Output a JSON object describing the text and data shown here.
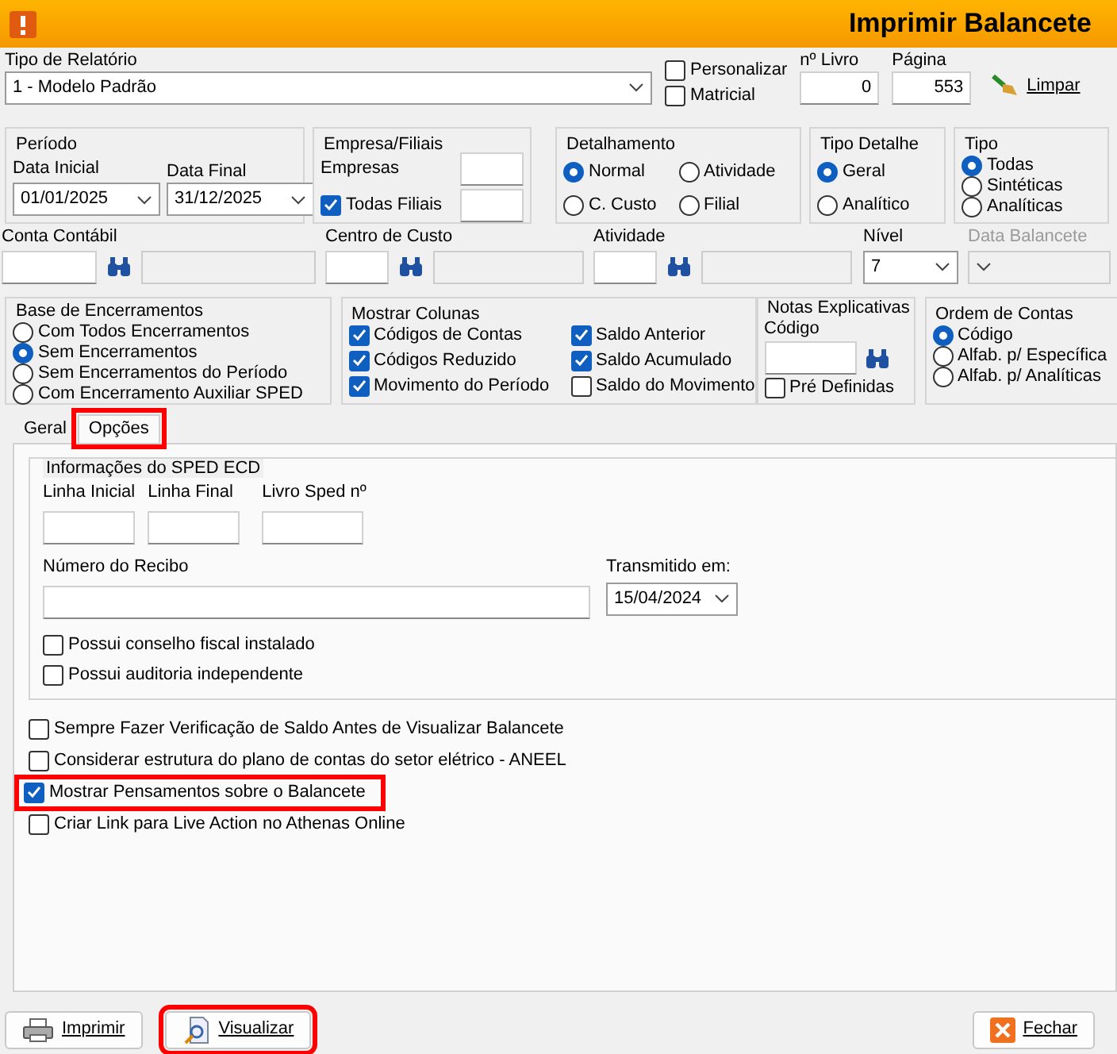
{
  "window": {
    "title": "Imprimir Balancete"
  },
  "report": {
    "type_label": "Tipo de Relatório",
    "type_value": "1 - Modelo Padrão",
    "options": [
      {
        "label": "Personalizar",
        "checked": false
      },
      {
        "label": "Matricial",
        "checked": false
      }
    ],
    "book_label": "nº Livro",
    "book_value": "0",
    "page_label": "Página",
    "page_value": "553",
    "clear_button": "Limpar"
  },
  "periodo": {
    "title": "Período",
    "start_label": "Data Inicial",
    "start_value": "01/01/2025",
    "end_label": "Data Final",
    "end_value": "31/12/2025"
  },
  "empresa": {
    "title": "Empresa/Filiais",
    "empresas_label": "Empresas",
    "filiais": {
      "label": "Todas Filiais",
      "checked": true
    }
  },
  "detalhamento": {
    "title": "Detalhamento",
    "options": [
      {
        "label": "Normal",
        "selected": true
      },
      {
        "label": "Atividade",
        "selected": false
      },
      {
        "label": "C. Custo",
        "selected": false
      },
      {
        "label": "Filial",
        "selected": false
      }
    ]
  },
  "tipo_detalhe": {
    "title": "Tipo Detalhe",
    "options": [
      {
        "label": "Geral",
        "selected": true
      },
      {
        "label": "Analítico",
        "selected": false
      }
    ]
  },
  "tipo": {
    "title": "Tipo",
    "options": [
      {
        "label": "Todas",
        "selected": true
      },
      {
        "label": "Sintéticas",
        "selected": false
      },
      {
        "label": "Analíticas",
        "selected": false
      }
    ]
  },
  "filters": [
    {
      "label": "Conta Contábil"
    },
    {
      "label": "Centro de Custo"
    },
    {
      "label": "Atividade"
    }
  ],
  "nivel": {
    "label": "Nível",
    "value": "7"
  },
  "data_balancete": {
    "label": "Data Balancete",
    "disabled": true
  },
  "base": {
    "title": "Base de Encerramentos",
    "options": [
      {
        "label": "Com Todos Encerramentos",
        "selected": false
      },
      {
        "label": "Sem Encerramentos",
        "selected": true
      },
      {
        "label": "Sem Encerramentos do Período",
        "selected": false
      },
      {
        "label": "Com Encerramento Auxiliar SPED",
        "selected": false
      }
    ]
  },
  "colunas": {
    "title": "Mostrar Colunas",
    "items": [
      {
        "label": "Códigos de Contas",
        "checked": true
      },
      {
        "label": "Saldo Anterior",
        "checked": true
      },
      {
        "label": "Códigos Reduzido",
        "checked": true
      },
      {
        "label": "Saldo Acumulado",
        "checked": true
      },
      {
        "label": "Movimento do Período",
        "checked": true
      },
      {
        "label": "Saldo do Movimento",
        "checked": false
      }
    ]
  },
  "notas": {
    "title": "Notas Explicativas",
    "code_label": "Código",
    "predefined": {
      "label": "Pré Definidas",
      "checked": false
    }
  },
  "ordem": {
    "title": "Ordem de Contas",
    "options": [
      {
        "label": "Código",
        "selected": true
      },
      {
        "label": "Alfab. p/  Específica",
        "selected": false
      },
      {
        "label": "Alfab. p/ Analíticas",
        "selected": false
      }
    ]
  },
  "tabs": [
    {
      "label": "Geral",
      "selected": false,
      "highlighted": false
    },
    {
      "label": "Opções",
      "selected": true,
      "highlighted": true
    }
  ],
  "sped": {
    "title": "Informações do SPED ECD",
    "fields": [
      {
        "label": "Linha Inicial"
      },
      {
        "label": "Linha Final"
      },
      {
        "label": "Livro Sped nº"
      }
    ],
    "recibo_label": "Número do Recibo",
    "transmitido_label": "Transmitido em:",
    "transmitido_value": "15/04/2024",
    "checks": [
      {
        "label": "Possui conselho fiscal instalado",
        "checked": false
      },
      {
        "label": "Possui auditoria independente",
        "checked": false
      }
    ]
  },
  "options": [
    {
      "label": "Sempre Fazer Verificação de Saldo Antes de Visualizar Balancete",
      "checked": false,
      "highlighted": false
    },
    {
      "label": "Considerar estrutura do plano de contas do setor elétrico - ANEEL",
      "checked": false,
      "highlighted": false
    },
    {
      "label": "Mostrar Pensamentos sobre o Balancete",
      "checked": true,
      "highlighted": true
    },
    {
      "label": "Criar Link para Live Action no Athenas Online",
      "checked": false,
      "highlighted": false
    }
  ],
  "buttons": [
    {
      "label": "Imprimir",
      "kind": "print",
      "highlighted": false
    },
    {
      "label": "Visualizar",
      "kind": "preview",
      "highlighted": true
    },
    {
      "label": "Fechar",
      "kind": "close",
      "highlighted": false
    }
  ]
}
